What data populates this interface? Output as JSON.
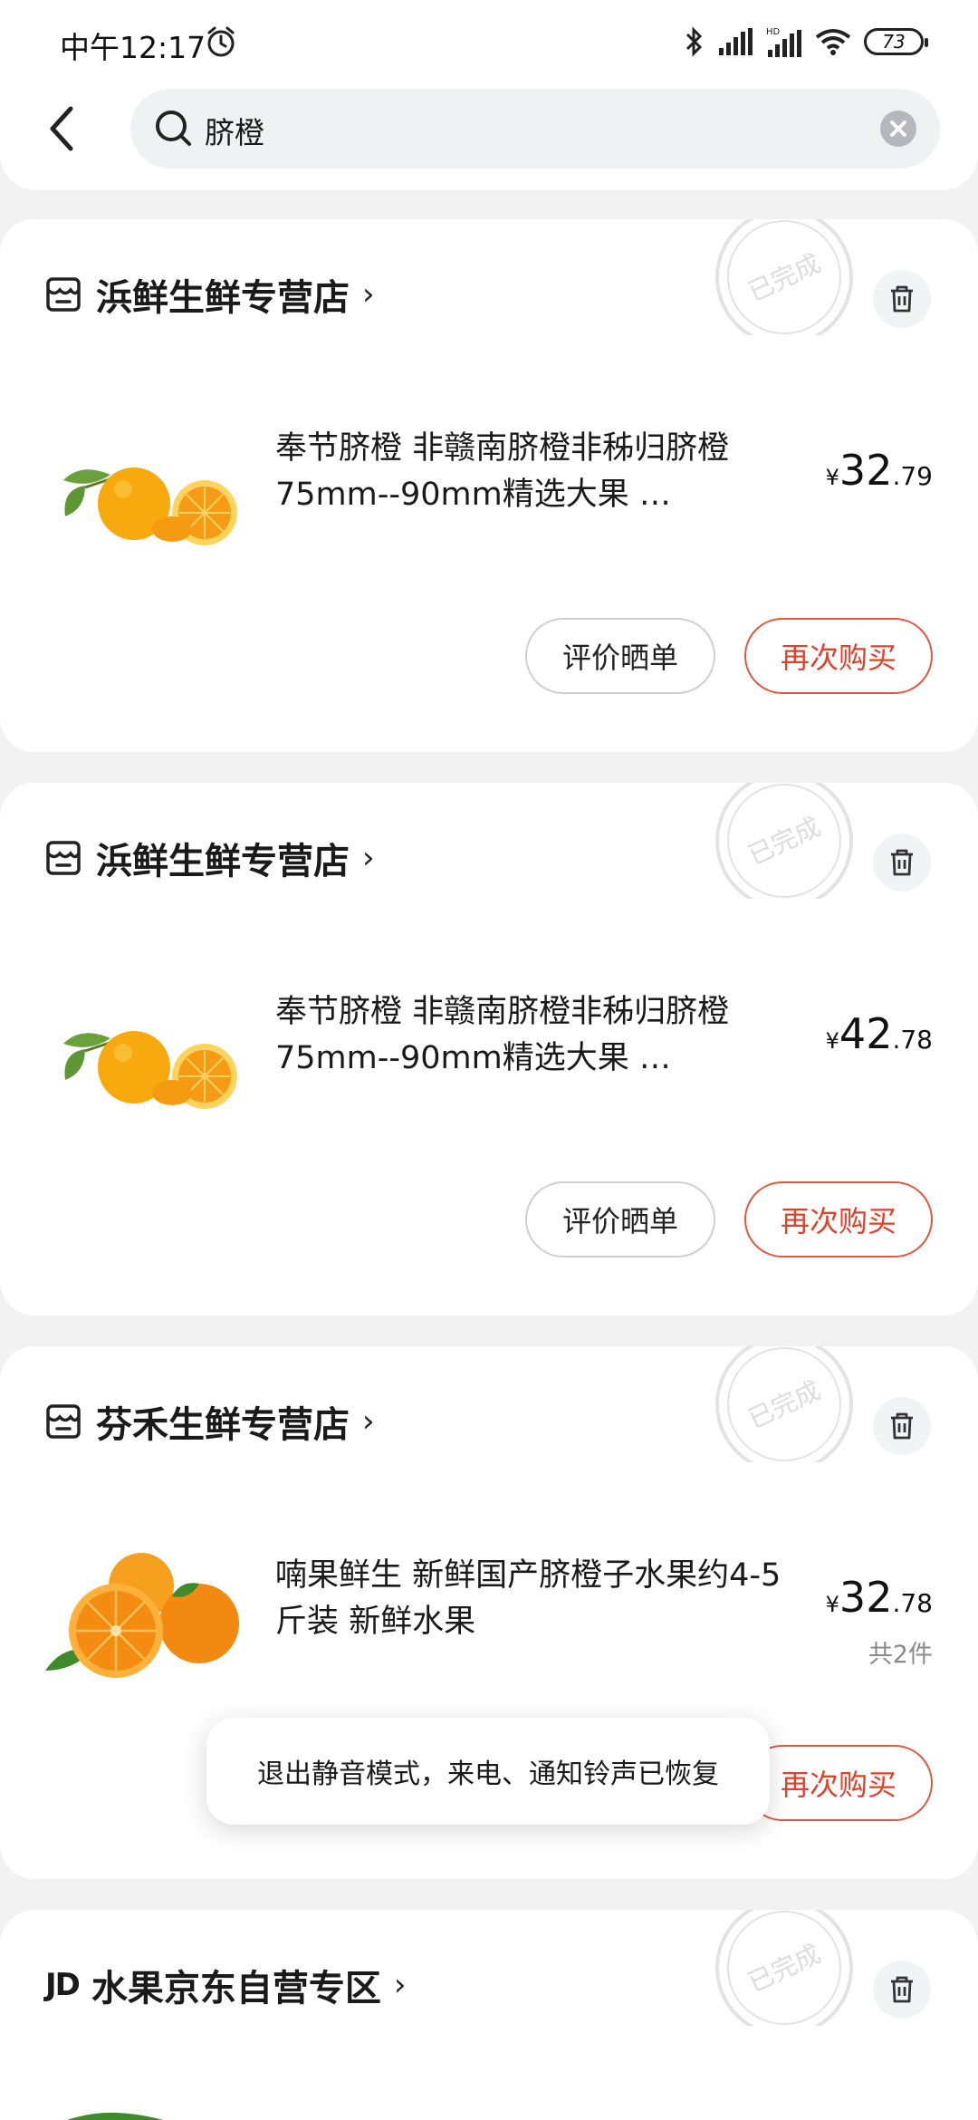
{
  "status_bar": {
    "time": "中午12:17",
    "battery": "73"
  },
  "search": {
    "query": "脐橙"
  },
  "stamp_text": "已完成",
  "orders": [
    {
      "shop_name": "浜鲜生鲜专营店",
      "product_title": "奉节脐橙  非赣南脐橙非秭归脐橙  75mm--90mm精选大果 …",
      "price_symbol": "¥",
      "price_int": "32",
      "price_dec": ".79",
      "quantity": "",
      "review_label": "评价晒单",
      "rebuy_label": "再次购买"
    },
    {
      "shop_name": "浜鲜生鲜专营店",
      "product_title": "奉节脐橙  非赣南脐橙非秭归脐橙  75mm--90mm精选大果 …",
      "price_symbol": "¥",
      "price_int": "42",
      "price_dec": ".78",
      "quantity": "",
      "review_label": "评价晒单",
      "rebuy_label": "再次购买"
    },
    {
      "shop_name": "芬禾生鲜专营店",
      "product_title": "喃果鲜生 新鲜国产脐橙子水果约4-5斤装 新鲜水果",
      "price_symbol": "¥",
      "price_int": "32",
      "price_dec": ".78",
      "quantity": "共2件",
      "review_label": "",
      "rebuy_label": "再次购买"
    },
    {
      "shop_logo": "JD",
      "shop_name": "水果京东自营专区"
    }
  ],
  "toast": {
    "message": "退出静音模式，来电、通知铃声已恢复"
  },
  "colors": {
    "accent": "#e0412a",
    "page_bg": "#f2f2f2",
    "card_bg": "#ffffff"
  }
}
